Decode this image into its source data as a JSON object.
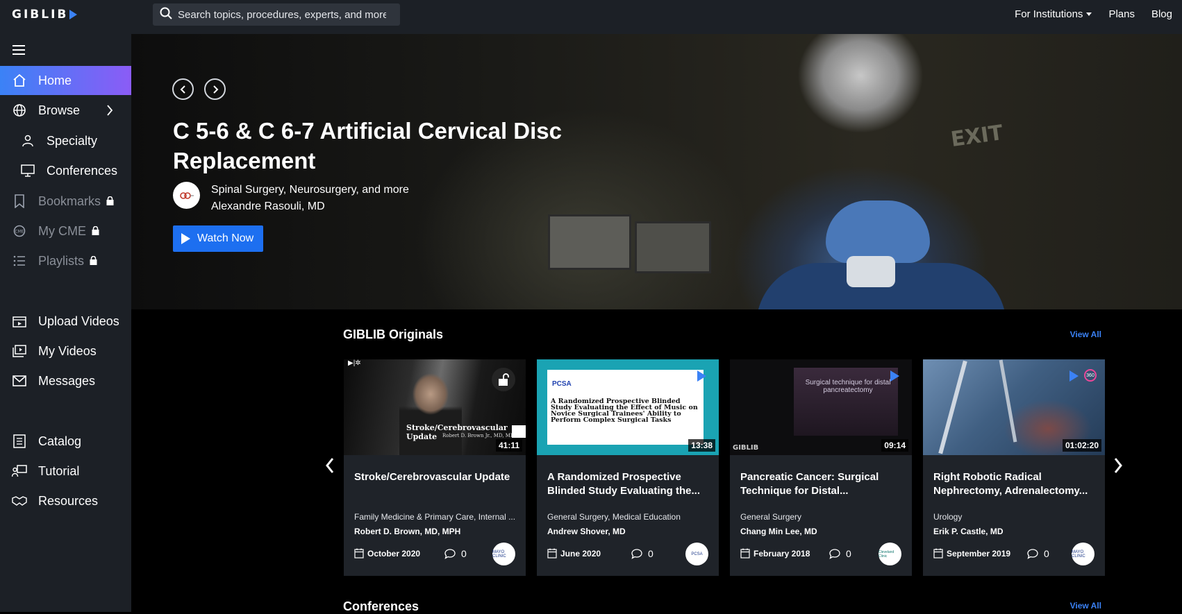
{
  "header": {
    "logo": "GIBLIB",
    "search_placeholder": "Search topics, procedures, experts, and more",
    "nav": [
      "For Institutions",
      "Plans",
      "Blog"
    ]
  },
  "sidebar": {
    "items": [
      {
        "label": "Home",
        "icon": "home-icon",
        "active": true
      },
      {
        "label": "Browse",
        "icon": "globe-icon"
      },
      {
        "label": "Specialty",
        "icon": "person-icon"
      },
      {
        "label": "Conferences",
        "icon": "monitor-icon"
      },
      {
        "label": "Bookmarks",
        "icon": "bookmark-icon",
        "locked": true
      },
      {
        "label": "My CME",
        "icon": "cme-icon",
        "locked": true
      },
      {
        "label": "Playlists",
        "icon": "list-icon",
        "locked": true
      },
      {
        "label": "Upload Videos",
        "icon": "upload-video-icon"
      },
      {
        "label": "My Videos",
        "icon": "video-library-icon"
      },
      {
        "label": "Messages",
        "icon": "mail-icon"
      },
      {
        "label": "Catalog",
        "icon": "catalog-icon"
      },
      {
        "label": "Tutorial",
        "icon": "tutorial-icon"
      },
      {
        "label": "Resources",
        "icon": "handshake-icon"
      }
    ]
  },
  "hero": {
    "title": "C 5-6 & C 6-7 Artificial Cervical Disc Replacement",
    "specialties": "Spinal Surgery, Neurosurgery, and more",
    "author": "Alexandre Rasouli, MD",
    "watch_label": "Watch Now",
    "exit_sign": "EXIT"
  },
  "originals": {
    "title": "GIBLIB Originals",
    "view_all": "View All",
    "cards": [
      {
        "title": "Stroke/Cerebrovascular Update",
        "specialty": "Family Medicine & Primary Care, Internal ...",
        "author": "Robert D. Brown, MD, MPH",
        "date": "October 2020",
        "comments": "0",
        "duration": "41:11",
        "thumb_caption": "Stroke/Cerebrovascular Update",
        "thumb_sub": "Robert D. Brown Jr., MD, MPH",
        "inst": "MAYO CLINIC"
      },
      {
        "title": "A Randomized Prospective Blinded Study Evaluating the...",
        "specialty": "General Surgery, Medical Education",
        "author": "Andrew Shover, MD",
        "date": "June 2020",
        "comments": "0",
        "duration": "13:38",
        "thumb_caption": "A Randomized Prospective Blinded Study Evaluating the Effect of Music on Novice Surgical Trainees' Ability to Perform Complex Surgical Tasks",
        "thumb_sub": "PCSA",
        "inst": "PCSA"
      },
      {
        "title": "Pancreatic Cancer: Surgical Technique for Distal...",
        "specialty": "General Surgery",
        "author": "Chang Min Lee, MD",
        "date": "February 2018",
        "comments": "0",
        "duration": "09:14",
        "thumb_caption": "Surgical technique for distal pancreatectomy",
        "thumb_sub": "GIBLIB",
        "inst": "Cleveland Clinic"
      },
      {
        "title": "Right Robotic Radical Nephrectomy, Adrenalectomy...",
        "specialty": "Urology",
        "author": "Erik P. Castle, MD",
        "date": "September 2019",
        "comments": "0",
        "duration": "01:02:20",
        "thumb_caption": "",
        "thumb_sub": "360",
        "inst": "MAYO CLINIC"
      }
    ]
  },
  "conferences": {
    "title": "Conferences",
    "view_all": "View All"
  }
}
